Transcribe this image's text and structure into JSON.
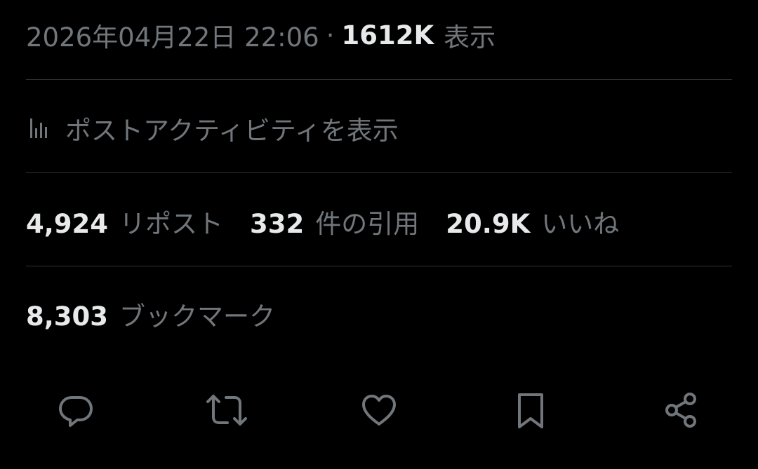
{
  "meta": {
    "timestamp": "2026年04月22日 22:06",
    "separator": "·",
    "views_count": "1612K",
    "views_label": "表示"
  },
  "activity": {
    "icon": "analytics-icon",
    "label": "ポストアクティビティを表示"
  },
  "stats": {
    "reposts_count": "4,924",
    "reposts_label": "リポスト",
    "quotes_count": "332",
    "quotes_label": "件の引用",
    "likes_count": "20.9K",
    "likes_label": "いいね"
  },
  "bookmarks": {
    "count": "8,303",
    "label": "ブックマーク"
  },
  "actions": {
    "icons": [
      "reply-icon",
      "repost-icon",
      "like-icon",
      "bookmark-icon",
      "share-icon"
    ]
  },
  "colors": {
    "background": "#000000",
    "text_primary": "#e7e9ea",
    "text_secondary": "#71767b",
    "divider": "#2f3336"
  }
}
